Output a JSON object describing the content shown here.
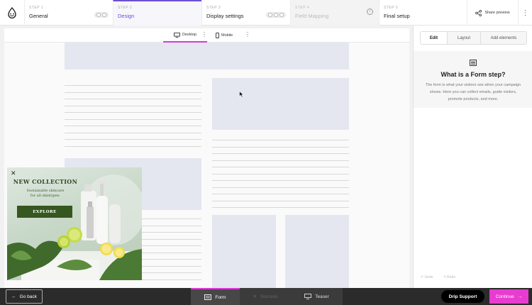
{
  "steps": [
    {
      "num": "STEP 1",
      "label": "General"
    },
    {
      "num": "STEP 2",
      "label": "Design"
    },
    {
      "num": "STEP 3",
      "label": "Display settings"
    },
    {
      "num": "STEP 4",
      "label": "Field Mapping"
    },
    {
      "num": "STEP 5",
      "label": "Final setup"
    }
  ],
  "header": {
    "share_label": "Share preview"
  },
  "devices": {
    "desktop": "Desktop",
    "mobile": "Mobile"
  },
  "popup": {
    "title": "NEW COLLECTION",
    "subtitle_line1": "Sustainable skincare",
    "subtitle_line2": "for all skintypes.",
    "button": "EXPLORE"
  },
  "panel": {
    "tabs": [
      "Edit",
      "Layout",
      "Add elements"
    ],
    "heading": "What is a Form step?",
    "description": "The form is what your visitors see when your campaign shows. Here you can collect emails, guide visitors, promote products, and more.",
    "undo": "Undo",
    "redo": "Redo"
  },
  "footer": {
    "back": "Go back",
    "tabs": [
      "Form",
      "Success",
      "Teaser"
    ],
    "support": "Drip Support",
    "continue": "Continue"
  },
  "colors": {
    "accent": "#6b4fd1",
    "pink": "#e83cd0",
    "popup_green": "#36571f"
  }
}
